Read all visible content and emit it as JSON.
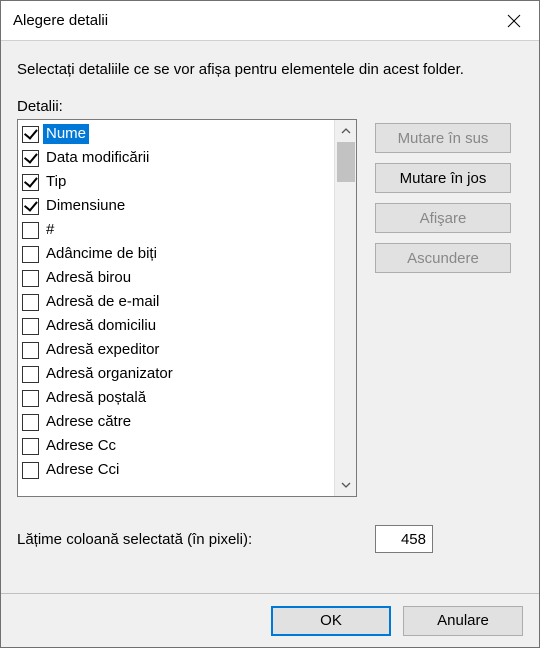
{
  "title": "Alegere detalii",
  "instruction": "Selectați detaliile ce se vor afișa pentru elementele din acest folder.",
  "detailsLabel": "Detalii:",
  "items": [
    {
      "label": "Nume",
      "checked": true,
      "selected": true
    },
    {
      "label": "Data modificării",
      "checked": true,
      "selected": false
    },
    {
      "label": "Tip",
      "checked": true,
      "selected": false
    },
    {
      "label": "Dimensiune",
      "checked": true,
      "selected": false
    },
    {
      "label": "#",
      "checked": false,
      "selected": false
    },
    {
      "label": "Adâncime de biți",
      "checked": false,
      "selected": false
    },
    {
      "label": "Adresă birou",
      "checked": false,
      "selected": false
    },
    {
      "label": "Adresă de e-mail",
      "checked": false,
      "selected": false
    },
    {
      "label": "Adresă domiciliu",
      "checked": false,
      "selected": false
    },
    {
      "label": "Adresă expeditor",
      "checked": false,
      "selected": false
    },
    {
      "label": "Adresă organizator",
      "checked": false,
      "selected": false
    },
    {
      "label": "Adresă poștală",
      "checked": false,
      "selected": false
    },
    {
      "label": "Adrese către",
      "checked": false,
      "selected": false
    },
    {
      "label": "Adrese Cc",
      "checked": false,
      "selected": false
    },
    {
      "label": "Adrese Cci",
      "checked": false,
      "selected": false
    }
  ],
  "buttons": {
    "moveUp": "Mutare în sus",
    "moveDown": "Mutare în jos",
    "show": "Afişare",
    "hide": "Ascundere"
  },
  "buttonsEnabled": {
    "moveUp": false,
    "moveDown": true,
    "show": false,
    "hide": false
  },
  "widthLabel": "Lățime coloană selectată (în pixeli):",
  "widthValue": "458",
  "footer": {
    "ok": "OK",
    "cancel": "Anulare"
  }
}
